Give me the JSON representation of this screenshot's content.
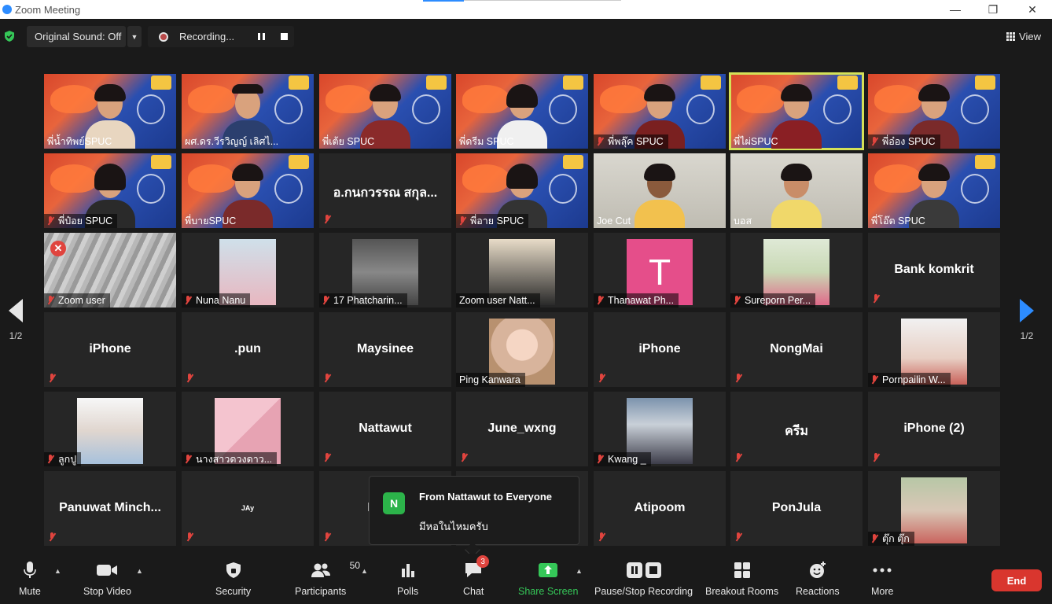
{
  "window": {
    "title": "Zoom Meeting",
    "minimize": "—",
    "maximize": "❐",
    "close": "✕"
  },
  "topbar": {
    "original_sound": "Original Sound: Off",
    "recording": "Recording...",
    "view": "View"
  },
  "pagination": {
    "left": "1/2",
    "right": "1/2"
  },
  "tiles": [
    "พี่น้ำทิพย์SPUC",
    "ผศ.ดร.วีรวิญญ์ เลิศไ...",
    "พี่เต้ย SPUC",
    "พี่ดรีม SPUC",
    "พี่พลุ๊ค SPUC",
    "พี่ไผ่SPUC",
    "พี่อ๋อง SPUC",
    "พี่ป๋อย SPUC",
    "พี่บายSPUC",
    "อ.กนกวรรณ สกุล...",
    "พี่อาย SPUC",
    "Joe Cut",
    "บอส",
    "พี่โอ๊ต SPUC",
    "Zoom user",
    "Nuna Nanu",
    "17 Phatcharin...",
    "Zoom user Natt...",
    "Thanawat Ph...",
    "Sureporn Per...",
    "Bank komkrit",
    "iPhone",
    ".pun",
    "Maysinee",
    "Ping Kanwara",
    "iPhone",
    "NongMai",
    "Pornpailin W...",
    "ลูกปู",
    "นางสาวดวงดาว...",
    "Nattawut",
    "June_wxng",
    "Kwang _",
    "ครีม",
    "iPhone (2)",
    "Panuwat  Minch...",
    "JAy",
    "Narue",
    "",
    "Atipoom",
    "PonJula",
    "ตุ๊ก ตุ๊ก"
  ],
  "avatar_letter": "T",
  "chat_toast": {
    "avatar_letter": "N",
    "from": "From Nattawut to Everyone",
    "message": "มีหอในไหมครับ"
  },
  "toolbar": {
    "mute": "Mute",
    "stop_video": "Stop Video",
    "security": "Security",
    "participants": "Participants",
    "participants_count": "50",
    "polls": "Polls",
    "chat": "Chat",
    "chat_badge": "3",
    "share_screen": "Share Screen",
    "pause_stop_recording": "Pause/Stop Recording",
    "breakout_rooms": "Breakout Rooms",
    "reactions": "Reactions",
    "more": "More",
    "end": "End"
  },
  "colors": {
    "accent": "#2d8cff",
    "end": "#d9362e",
    "share": "#35c758",
    "active_speaker": "#d4e157",
    "muted": "#e0443e"
  }
}
